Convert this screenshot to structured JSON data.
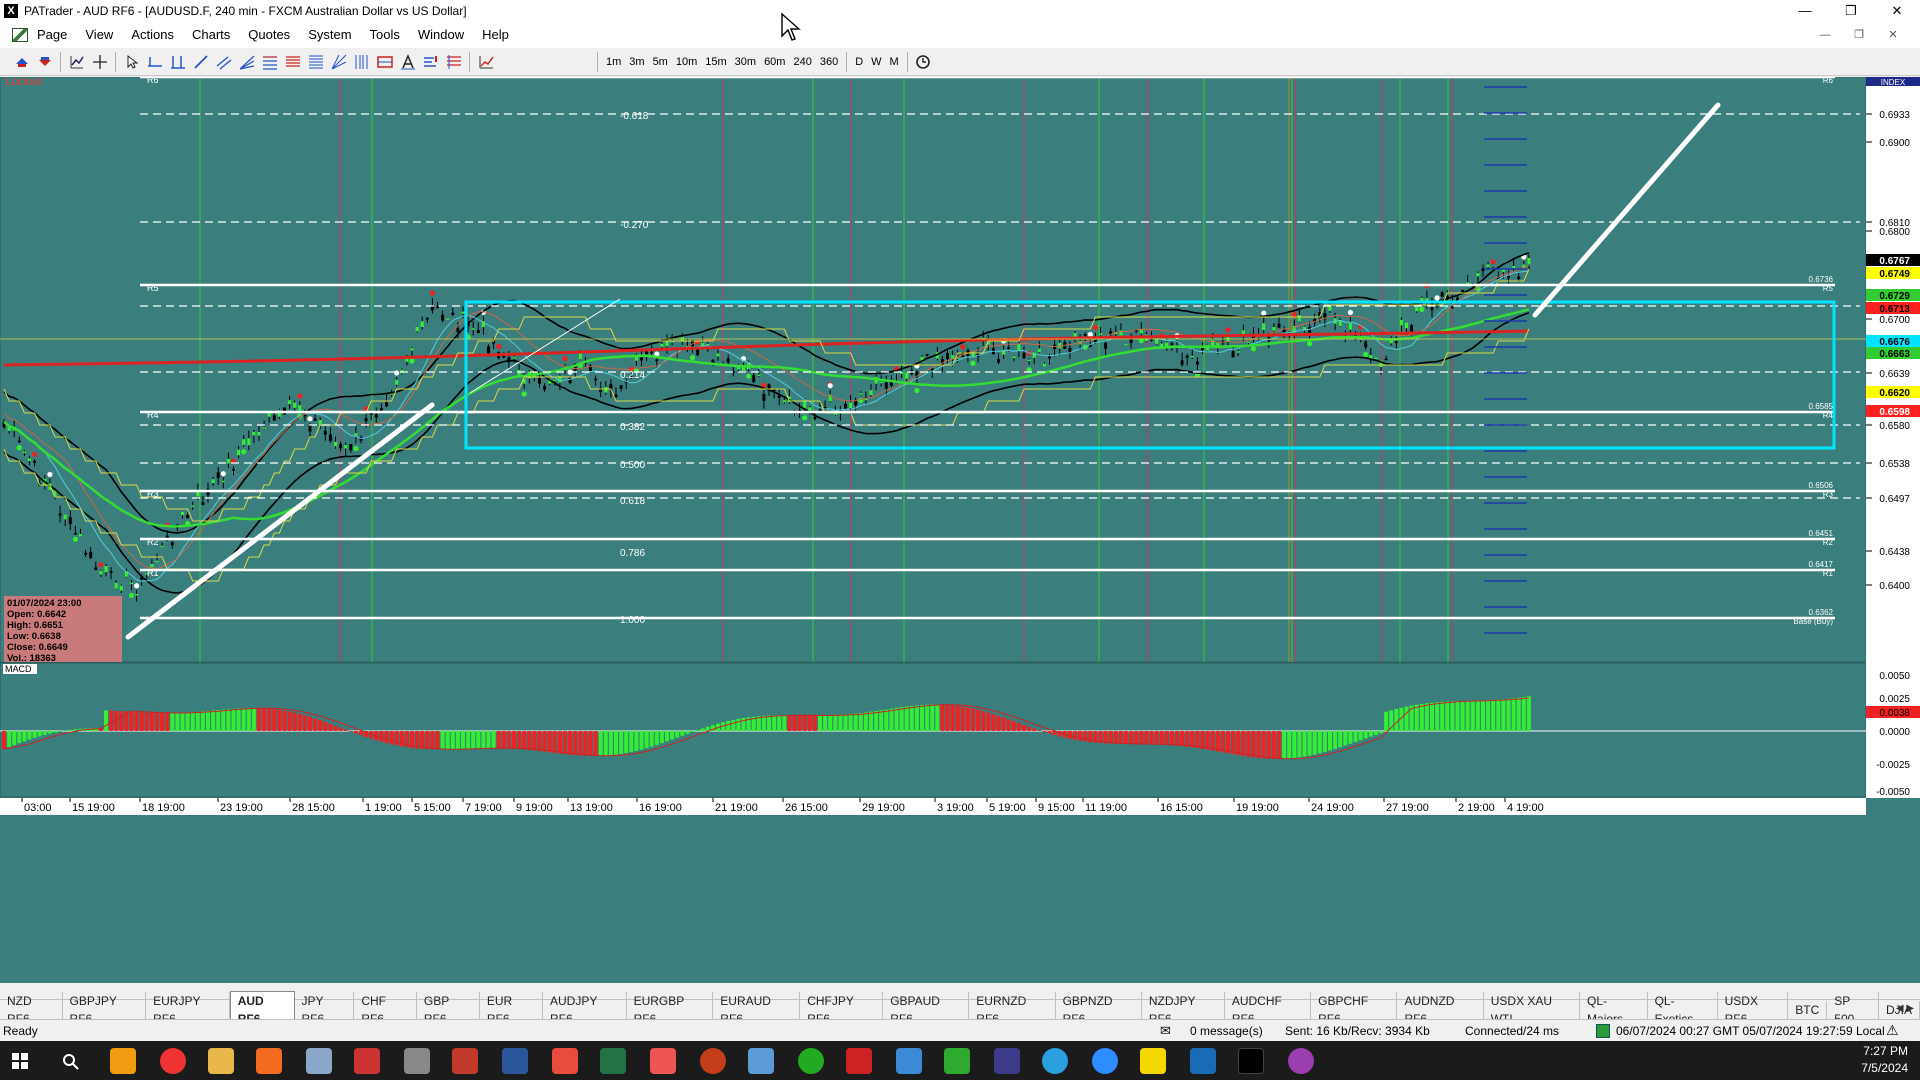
{
  "window": {
    "title": "PATrader - AUD RF6 - [AUDUSD.F, 240 min - FXCM Australian Dollar vs US Dollar]",
    "app_icon": "X",
    "minimize": "—",
    "restore": "❐",
    "close": "✕"
  },
  "menu": {
    "items": [
      "Page",
      "View",
      "Actions",
      "Charts",
      "Quotes",
      "System",
      "Tools",
      "Window",
      "Help"
    ],
    "mdi_minimize": "—",
    "mdi_restore": "❐",
    "mdi_close": "✕"
  },
  "toolbar": {
    "timeframes": [
      "1m",
      "3m",
      "5m",
      "10m",
      "15m",
      "30m",
      "60m",
      "240",
      "360"
    ],
    "periods": [
      "D",
      "W",
      "M"
    ]
  },
  "chart": {
    "locked_label": "Locked",
    "index_label": "INDEX",
    "pivots": [
      {
        "name": "R6",
        "value": "0.6972"
      },
      {
        "name": "R5",
        "value": "0.6736"
      },
      {
        "name": "R4",
        "value": "0.6585"
      },
      {
        "name": "R3",
        "value": "0.6506"
      },
      {
        "name": "R2",
        "value": "0.6451"
      },
      {
        "name": "R1",
        "value": "0.6417"
      },
      {
        "name": "Base (Buy)",
        "value": "0.6362"
      }
    ],
    "fib_levels": [
      "-0.618",
      "-0.270",
      "0.214",
      "0.382",
      "0.500",
      "0.618",
      "0.786",
      "1.000"
    ],
    "price_axis": [
      "0.6933",
      "0.6900",
      "0.6810",
      "0.6800",
      "0.6700",
      "0.6639",
      "0.6580",
      "0.6538",
      "0.6497",
      "0.6438",
      "0.6400"
    ],
    "price_tags": [
      {
        "value": "0.6767",
        "bg": "#000000",
        "fg": "#ffffff"
      },
      {
        "value": "0.6749",
        "bg": "#ffff00",
        "fg": "#000000"
      },
      {
        "value": "0.6729",
        "bg": "#33cc33",
        "fg": "#000000"
      },
      {
        "value": "0.6713",
        "bg": "#ff2020",
        "fg": "#000000"
      },
      {
        "value": "0.6676",
        "bg": "#00e5ff",
        "fg": "#000000"
      },
      {
        "value": "0.6663",
        "bg": "#33cc33",
        "fg": "#000000"
      },
      {
        "value": "0.6620",
        "bg": "#ffff00",
        "fg": "#000000"
      },
      {
        "value": "0.6598",
        "bg": "#ff2020",
        "fg": "#ffffff"
      }
    ],
    "ohlc": {
      "date": "01/07/2024 23:00",
      "open": "Open: 0.6642",
      "high": "High: 0.6651",
      "low": "Low: 0.6638",
      "close": "Close: 0.6649",
      "vol": "Vol.: 18363"
    },
    "macd_label": "MACD",
    "macd_axis": [
      "0.0050",
      "0.0025",
      "0.0000",
      "-0.0025",
      "-0.0050"
    ],
    "macd_tag": "0.0038",
    "time_axis": [
      "03:00",
      "15 19:00",
      "18 19:00",
      "23 19:00",
      "28 15:00",
      "1 19:00",
      "5 15:00",
      "7 19:00",
      "9 19:00",
      "13 19:00",
      "16 19:00",
      "21 19:00",
      "26 15:00",
      "29 19:00",
      "3 19:00",
      "5 19:00",
      "9 15:00",
      "11 19:00",
      "16 15:00",
      "19 19:00",
      "24 19:00",
      "27 19:00",
      "2 19:00",
      "4 19:00"
    ],
    "colors": {
      "background": "#3a7f7d",
      "pivot_line": "#ffffff",
      "box": "#00e5ff",
      "sma_long": "#dd2222",
      "sma_mid": "#33dd33",
      "bollinger": "#000000",
      "envelope": "#d8d84a"
    }
  },
  "tabs": {
    "items": [
      "NZD RF6",
      "GBPJPY RF6",
      "EURJPY RF6",
      "AUD RF6",
      "JPY RF6",
      "CHF RF6",
      "GBP RF6",
      "EUR RF6",
      "AUDJPY RF6",
      "EURGBP RF6",
      "EURAUD RF6",
      "CHFJPY RF6",
      "GBPAUD RF6",
      "EURNZD RF6",
      "GBPNZD RF6",
      "NZDJPY RF6",
      "AUDCHF RF6",
      "GBPCHF RF6",
      "AUDNZD RF6",
      "USDX XAU WTI",
      "QL-Majors",
      "QL-Exotics",
      "USDX RF6",
      "BTC",
      "SP 500",
      "DJIA"
    ],
    "active": "AUD RF6"
  },
  "status": {
    "ready": "Ready",
    "messages": "0 message(s)",
    "traffic": "Sent: 16 Kb/Recv: 3934 Kb",
    "connection": "Connected/24 ms",
    "times": "06/07/2024 00:27 GMT  05/07/2024 19:27:59 Local"
  },
  "tray": {
    "time": "7:27 PM",
    "date": "7/5/2024"
  }
}
